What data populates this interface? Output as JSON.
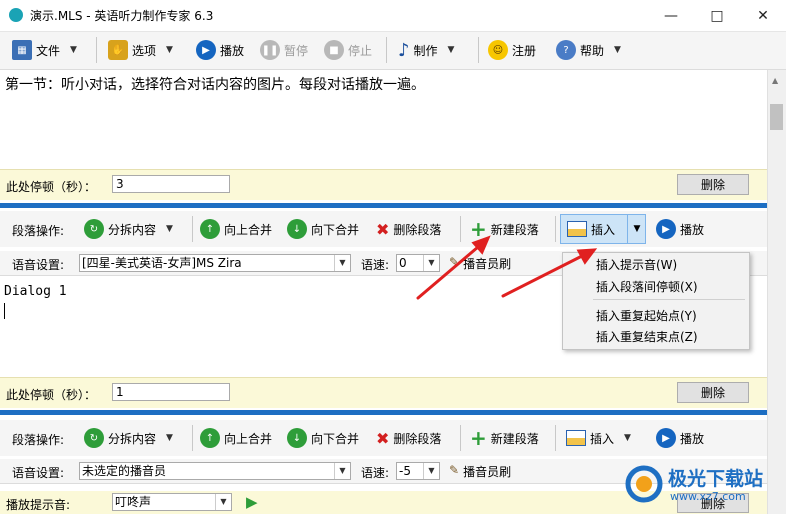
{
  "window": {
    "title": "演示.MLS - 英语听力制作专家 6.3"
  },
  "toolbar": {
    "file": "文件",
    "options": "选项",
    "play": "播放",
    "pause": "暂停",
    "stop": "停止",
    "make": "制作",
    "register": "注册",
    "help": "帮助"
  },
  "section_text": "第一节：听小对话，选择符合对话内容的图片。每段对话播放一遍。",
  "pause1": {
    "label": "此处停顿（秒）：",
    "value": "3",
    "delete": "删除"
  },
  "seg1": {
    "label": "段落操作:",
    "split": "分拆内容",
    "merge_up": "向上合并",
    "merge_down": "向下合并",
    "delete_para": "删除段落",
    "new_para": "新建段落",
    "insert": "插入",
    "play": "播放",
    "voice_label": "语音设置:",
    "voice_value": "[四星-美式英语-女声]MS Zira",
    "speed_label": "语速:",
    "speed_value": "0",
    "brush": "播音员刷",
    "text": "Dialog 1"
  },
  "insert_menu": {
    "items": [
      "插入提示音(W)",
      "插入段落间停顿(X)",
      "插入重复起始点(Y)",
      "插入重复结束点(Z)"
    ]
  },
  "pause2": {
    "label": "此处停顿（秒）：",
    "value": "1",
    "delete": "删除"
  },
  "seg2": {
    "label": "段落操作:",
    "split": "分拆内容",
    "merge_up": "向上合并",
    "merge_down": "向下合并",
    "delete_para": "删除段落",
    "new_para": "新建段落",
    "insert": "插入",
    "play": "播放",
    "voice_label": "语音设置:",
    "voice_value": "未选定的播音员",
    "speed_label": "语速:",
    "speed_value": "-5",
    "brush": "播音员刷"
  },
  "prompt_row": {
    "label": "播放提示音:",
    "value": "叮咚声",
    "delete": "删除"
  },
  "watermark": {
    "text": "极光下载站",
    "url": "www.xz7.com"
  }
}
